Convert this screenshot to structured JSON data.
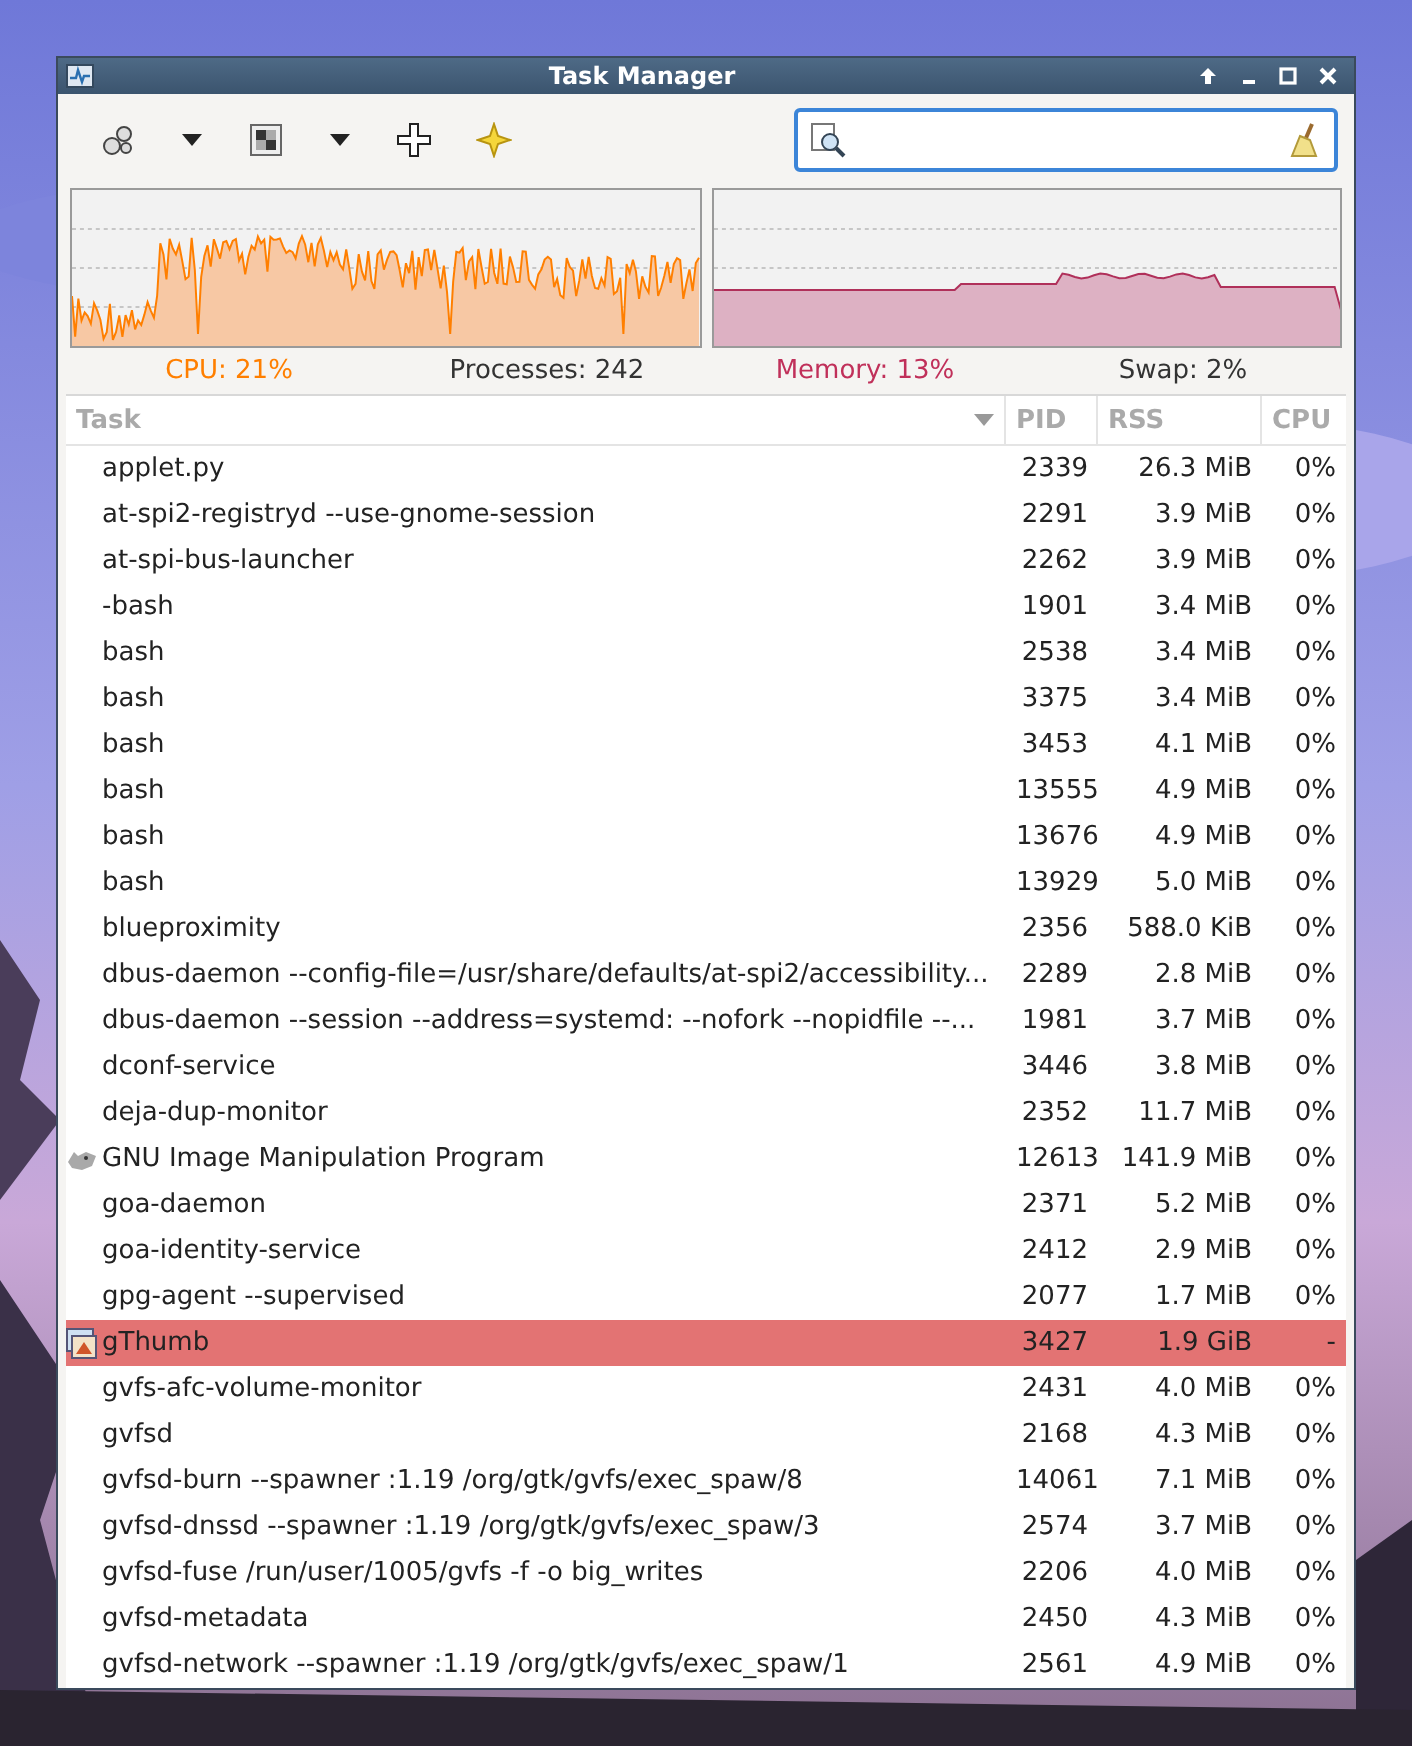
{
  "window": {
    "title": "Task Manager"
  },
  "summary": {
    "cpu": "CPU: 21%",
    "processes": "Processes: 242",
    "memory": "Memory: 13%",
    "swap": "Swap: 2%"
  },
  "table": {
    "columns": [
      {
        "label": "Task",
        "sorted": true
      },
      {
        "label": "PID",
        "sorted": false
      },
      {
        "label": "RSS",
        "sorted": false
      },
      {
        "label": "CPU",
        "sorted": false
      }
    ],
    "rows": [
      {
        "kind": "process",
        "task": "applet.py",
        "pid": "2339",
        "rss": "26.3 MiB",
        "cpu": "0%",
        "highlighted": false
      },
      {
        "kind": "process",
        "task": "at-spi2-registryd --use-gnome-session",
        "pid": "2291",
        "rss": "3.9 MiB",
        "cpu": "0%",
        "highlighted": false
      },
      {
        "kind": "process",
        "task": "at-spi-bus-launcher",
        "pid": "2262",
        "rss": "3.9 MiB",
        "cpu": "0%",
        "highlighted": false
      },
      {
        "kind": "process",
        "task": "-bash",
        "pid": "1901",
        "rss": "3.4 MiB",
        "cpu": "0%",
        "highlighted": false
      },
      {
        "kind": "process",
        "task": "bash",
        "pid": "2538",
        "rss": "3.4 MiB",
        "cpu": "0%",
        "highlighted": false
      },
      {
        "kind": "process",
        "task": "bash",
        "pid": "3375",
        "rss": "3.4 MiB",
        "cpu": "0%",
        "highlighted": false
      },
      {
        "kind": "process",
        "task": "bash",
        "pid": "3453",
        "rss": "4.1 MiB",
        "cpu": "0%",
        "highlighted": false
      },
      {
        "kind": "process",
        "task": "bash",
        "pid": "13555",
        "rss": "4.9 MiB",
        "cpu": "0%",
        "highlighted": false
      },
      {
        "kind": "process",
        "task": "bash",
        "pid": "13676",
        "rss": "4.9 MiB",
        "cpu": "0%",
        "highlighted": false
      },
      {
        "kind": "process",
        "task": "bash",
        "pid": "13929",
        "rss": "5.0 MiB",
        "cpu": "0%",
        "highlighted": false
      },
      {
        "kind": "process",
        "task": "blueproximity",
        "pid": "2356",
        "rss": "588.0 KiB",
        "cpu": "0%",
        "highlighted": false
      },
      {
        "kind": "process",
        "task": "dbus-daemon --config-file=/usr/share/defaults/at-spi2/accessibility...",
        "pid": "2289",
        "rss": "2.8 MiB",
        "cpu": "0%",
        "highlighted": false
      },
      {
        "kind": "process",
        "task": "dbus-daemon --session --address=systemd: --nofork --nopidfile --...",
        "pid": "1981",
        "rss": "3.7 MiB",
        "cpu": "0%",
        "highlighted": false
      },
      {
        "kind": "process",
        "task": "dconf-service",
        "pid": "3446",
        "rss": "3.8 MiB",
        "cpu": "0%",
        "highlighted": false
      },
      {
        "kind": "process",
        "task": "deja-dup-monitor",
        "pid": "2352",
        "rss": "11.7 MiB",
        "cpu": "0%",
        "highlighted": false
      },
      {
        "kind": "app",
        "task": "GNU Image Manipulation Program",
        "pid": "12613",
        "rss": "141.9 MiB",
        "cpu": "0%",
        "highlighted": false
      },
      {
        "kind": "process",
        "task": "goa-daemon",
        "pid": "2371",
        "rss": "5.2 MiB",
        "cpu": "0%",
        "highlighted": false
      },
      {
        "kind": "process",
        "task": "goa-identity-service",
        "pid": "2412",
        "rss": "2.9 MiB",
        "cpu": "0%",
        "highlighted": false
      },
      {
        "kind": "process",
        "task": "gpg-agent --supervised",
        "pid": "2077",
        "rss": "1.7 MiB",
        "cpu": "0%",
        "highlighted": false
      },
      {
        "kind": "app",
        "task": "gThumb",
        "pid": "3427",
        "rss": "1.9 GiB",
        "cpu": "-",
        "highlighted": true
      },
      {
        "kind": "process",
        "task": "gvfs-afc-volume-monitor",
        "pid": "2431",
        "rss": "4.0 MiB",
        "cpu": "0%",
        "highlighted": false
      },
      {
        "kind": "process",
        "task": "gvfsd",
        "pid": "2168",
        "rss": "4.3 MiB",
        "cpu": "0%",
        "highlighted": false
      },
      {
        "kind": "process",
        "task": "gvfsd-burn --spawner :1.19 /org/gtk/gvfs/exec_spaw/8",
        "pid": "14061",
        "rss": "7.1 MiB",
        "cpu": "0%",
        "highlighted": false
      },
      {
        "kind": "process",
        "task": "gvfsd-dnssd --spawner :1.19 /org/gtk/gvfs/exec_spaw/3",
        "pid": "2574",
        "rss": "3.7 MiB",
        "cpu": "0%",
        "highlighted": false
      },
      {
        "kind": "process",
        "task": "gvfsd-fuse /run/user/1005/gvfs -f -o big_writes",
        "pid": "2206",
        "rss": "4.0 MiB",
        "cpu": "0%",
        "highlighted": false
      },
      {
        "kind": "process",
        "task": "gvfsd-metadata",
        "pid": "2450",
        "rss": "4.3 MiB",
        "cpu": "0%",
        "highlighted": false
      },
      {
        "kind": "process",
        "task": "gvfsd-network --spawner :1.19 /org/gtk/gvfs/exec_spaw/1",
        "pid": "2561",
        "rss": "4.9 MiB",
        "cpu": "0%",
        "highlighted": false
      }
    ]
  }
}
